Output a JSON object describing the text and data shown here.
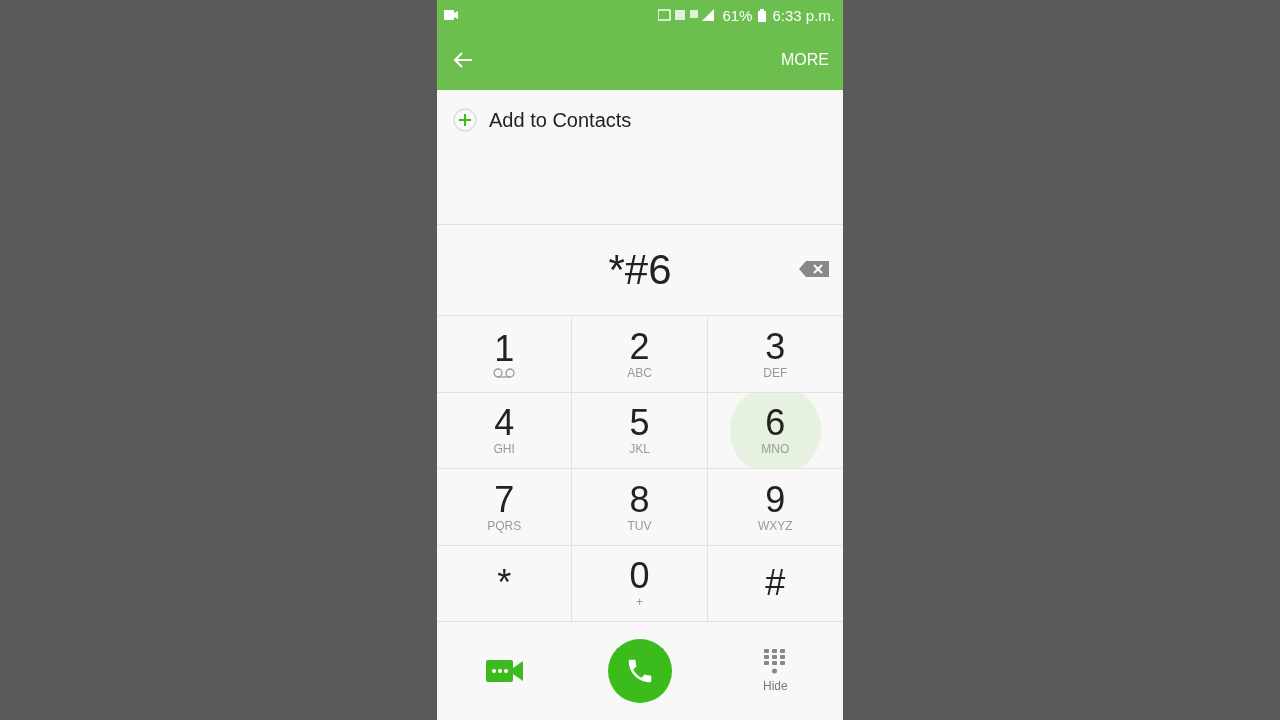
{
  "status_bar": {
    "battery": "61%",
    "time": "6:33 p.m."
  },
  "toolbar": {
    "more": "MORE"
  },
  "add_contact": {
    "label": "Add to Contacts"
  },
  "display": {
    "number": "*#6"
  },
  "keys": [
    {
      "digit": "1",
      "kind": "voicemail",
      "selected": false
    },
    {
      "digit": "2",
      "letters": "ABC",
      "kind": "letters",
      "selected": false
    },
    {
      "digit": "3",
      "letters": "DEF",
      "kind": "letters",
      "selected": false
    },
    {
      "digit": "4",
      "letters": "GHI",
      "kind": "letters",
      "selected": false
    },
    {
      "digit": "5",
      "letters": "JKL",
      "kind": "letters",
      "selected": false
    },
    {
      "digit": "6",
      "letters": "MNO",
      "kind": "letters",
      "selected": true
    },
    {
      "digit": "7",
      "letters": "PQRS",
      "kind": "letters",
      "selected": false
    },
    {
      "digit": "8",
      "letters": "TUV",
      "kind": "letters",
      "selected": false
    },
    {
      "digit": "9",
      "letters": "WXYZ",
      "kind": "letters",
      "selected": false
    },
    {
      "digit": "*",
      "kind": "symbol",
      "selected": false
    },
    {
      "digit": "0",
      "letters": "+",
      "kind": "letters",
      "selected": false
    },
    {
      "digit": "#",
      "kind": "symbol",
      "selected": false
    }
  ],
  "bottom_bar": {
    "hide": "Hide"
  }
}
